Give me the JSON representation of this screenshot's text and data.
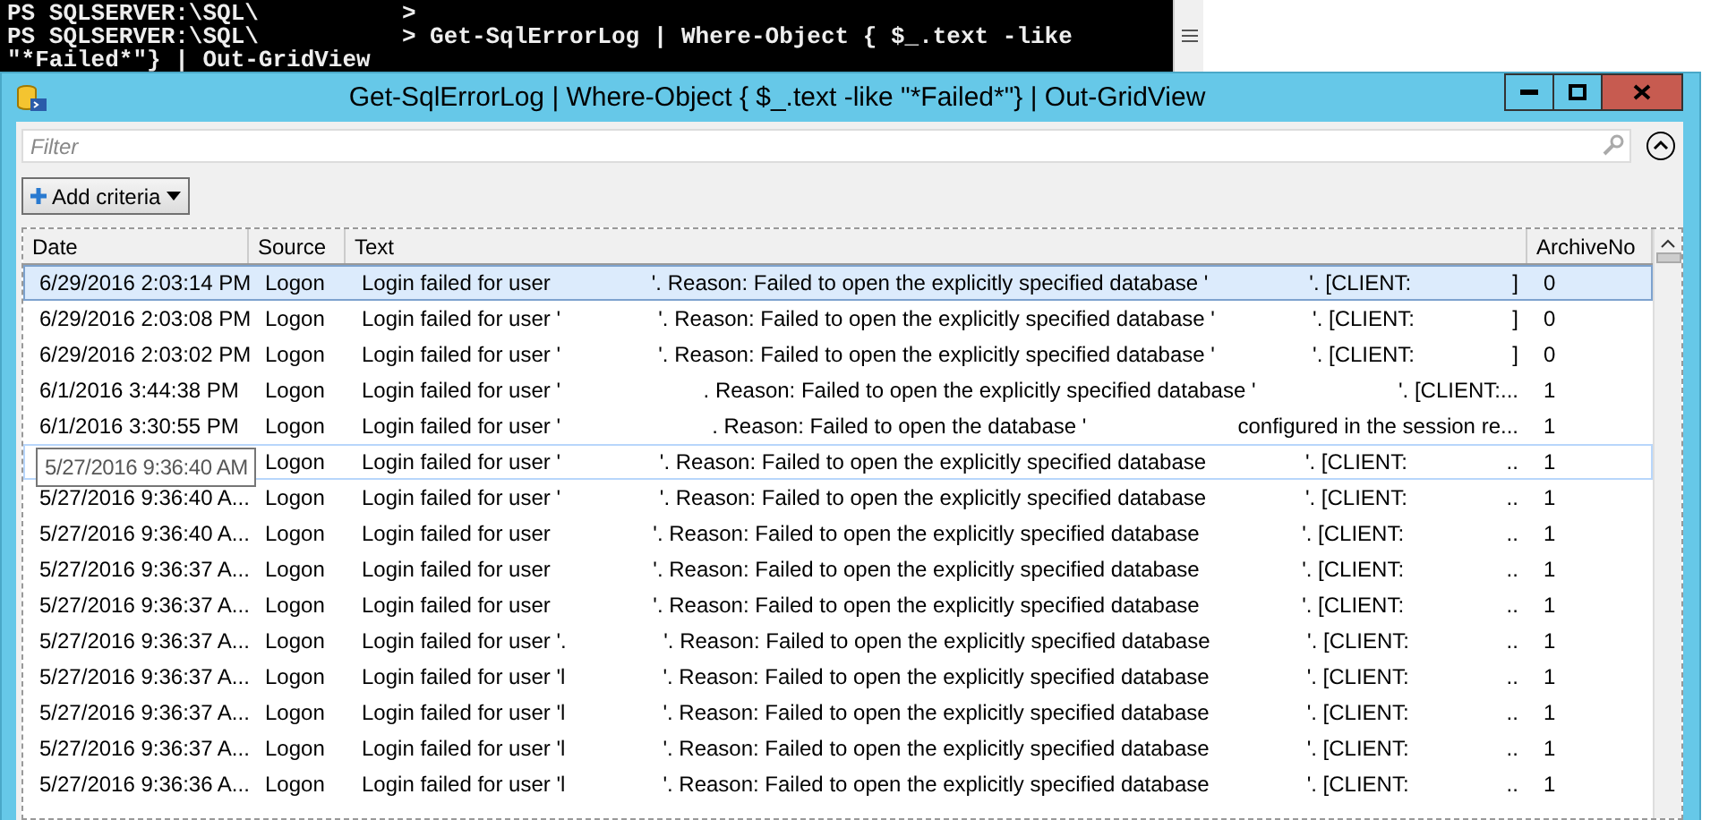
{
  "console": {
    "lines": [
      [
        "PS SQLSERVER:\\SQL\\",
        ">"
      ],
      [
        "PS SQLSERVER:\\SQL\\",
        "> Get-SqlErrorLog | Where-Object { $_.text -like"
      ],
      [
        "\"*Failed*\"} | Out-GridView"
      ]
    ]
  },
  "window": {
    "title": "Get-SqlErrorLog | Where-Object { $_.text -like \"*Failed*\"} | Out-GridView"
  },
  "filter": {
    "placeholder": "Filter"
  },
  "add_criteria": {
    "label": "Add criteria"
  },
  "table": {
    "columns": [
      "Date",
      "Source",
      "Text",
      "ArchiveNo"
    ],
    "rows": [
      {
        "date": "6/29/2016 2:03:14 PM",
        "source": "Logon",
        "text": [
          "Login failed for user",
          "'. Reason: Failed to open the explicitly specified database '",
          "'. [CLIENT:",
          "]"
        ],
        "archive": "0",
        "selected": true,
        "hovered": false
      },
      {
        "date": "6/29/2016 2:03:08 PM",
        "source": "Logon",
        "text": [
          "Login failed for user '",
          "'. Reason: Failed to open the explicitly specified database '",
          "'. [CLIENT:",
          "]"
        ],
        "archive": "0",
        "selected": false,
        "hovered": false
      },
      {
        "date": "6/29/2016 2:03:02 PM",
        "source": "Logon",
        "text": [
          "Login failed for user '",
          "'. Reason: Failed to open the explicitly specified database '",
          "'. [CLIENT:",
          "]"
        ],
        "archive": "0",
        "selected": false,
        "hovered": false
      },
      {
        "date": "6/1/2016 3:44:38 PM",
        "source": "Logon",
        "text": [
          "Login failed for user '",
          ". Reason: Failed to open the explicitly specified database '",
          "'. [CLIENT:..."
        ],
        "archive": "1",
        "selected": false,
        "hovered": false
      },
      {
        "date": "6/1/2016 3:30:55 PM",
        "source": "Logon",
        "text": [
          "Login failed for user '",
          ". Reason: Failed to open the database '",
          "configured in the session re..."
        ],
        "archive": "1",
        "selected": false,
        "hovered": false
      },
      {
        "tooltip": "5/27/2016 9:36:40 AM",
        "source": "Logon",
        "text": [
          "Login failed for user '",
          "'. Reason: Failed to open the explicitly specified database",
          "'. [CLIENT:",
          ".."
        ],
        "archive": "1",
        "selected": false,
        "hovered": true
      },
      {
        "date": "5/27/2016 9:36:40 A...",
        "source": "Logon",
        "text": [
          "Login failed for user '",
          "'. Reason: Failed to open the explicitly specified database",
          "'. [CLIENT:",
          ".."
        ],
        "archive": "1",
        "selected": false,
        "hovered": false
      },
      {
        "date": "5/27/2016 9:36:40 A...",
        "source": "Logon",
        "text": [
          "Login failed for user",
          "'. Reason: Failed to open the explicitly specified database",
          "'. [CLIENT:",
          ".."
        ],
        "archive": "1",
        "selected": false,
        "hovered": false
      },
      {
        "date": "5/27/2016 9:36:37 A...",
        "source": "Logon",
        "text": [
          "Login failed for user",
          "'. Reason: Failed to open the explicitly specified database",
          "'. [CLIENT:",
          ".."
        ],
        "archive": "1",
        "selected": false,
        "hovered": false
      },
      {
        "date": "5/27/2016 9:36:37 A...",
        "source": "Logon",
        "text": [
          "Login failed for user",
          "'. Reason: Failed to open the explicitly specified database",
          "'. [CLIENT:",
          ".."
        ],
        "archive": "1",
        "selected": false,
        "hovered": false
      },
      {
        "date": "5/27/2016 9:36:37 A...",
        "source": "Logon",
        "text": [
          "Login failed for user '.",
          "'. Reason: Failed to open the explicitly specified database",
          "'. [CLIENT:",
          ".."
        ],
        "archive": "1",
        "selected": false,
        "hovered": false
      },
      {
        "date": "5/27/2016 9:36:37 A...",
        "source": "Logon",
        "text": [
          "Login failed for user 'l",
          "'. Reason: Failed to open the explicitly specified database",
          "'. [CLIENT:",
          ".."
        ],
        "archive": "1",
        "selected": false,
        "hovered": false
      },
      {
        "date": "5/27/2016 9:36:37 A...",
        "source": "Logon",
        "text": [
          "Login failed for user 'l",
          "'. Reason: Failed to open the explicitly specified database",
          "'. [CLIENT:",
          ".."
        ],
        "archive": "1",
        "selected": false,
        "hovered": false
      },
      {
        "date": "5/27/2016 9:36:37 A...",
        "source": "Logon",
        "text": [
          "Login failed for user 'l",
          "'. Reason: Failed to open the explicitly specified database",
          "'. [CLIENT:",
          ".."
        ],
        "archive": "1",
        "selected": false,
        "hovered": false
      },
      {
        "date": "5/27/2016 9:36:36 A...",
        "source": "Logon",
        "text": [
          "Login failed for user 'l",
          "'. Reason: Failed to open the explicitly specified database",
          "'. [CLIENT:",
          ".."
        ],
        "archive": "1",
        "selected": false,
        "hovered": false
      }
    ]
  }
}
